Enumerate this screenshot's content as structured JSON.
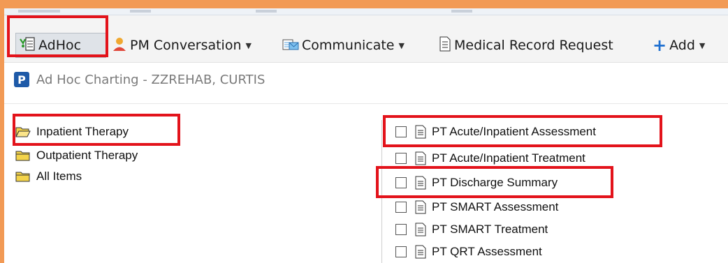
{
  "toolbar": {
    "adhoc_label": "AdHoc",
    "pm_conversation_label": "PM Conversation",
    "communicate_label": "Communicate",
    "medical_record_request_label": "Medical Record Request",
    "add_label": "Add"
  },
  "header": {
    "badge": "P",
    "title": "Ad Hoc Charting - ZZREHAB, CURTIS"
  },
  "folders": [
    {
      "label": "Inpatient Therapy",
      "open": true
    },
    {
      "label": "Outpatient Therapy",
      "open": false
    },
    {
      "label": "All Items",
      "open": false
    }
  ],
  "documents": [
    {
      "label": "PT Acute/Inpatient Assessment",
      "checked": false
    },
    {
      "label": "PT Acute/Inpatient Treatment",
      "checked": false
    },
    {
      "label": "PT Discharge Summary",
      "checked": false
    },
    {
      "label": "PT SMART Assessment",
      "checked": false
    },
    {
      "label": "PT SMART Treatment",
      "checked": false
    },
    {
      "label": "PT QRT Assessment",
      "checked": false
    }
  ],
  "colors": {
    "frame": "#f29a55",
    "highlight": "#e3131b",
    "badge": "#1e5aa8",
    "folder": "#f3d34a"
  }
}
